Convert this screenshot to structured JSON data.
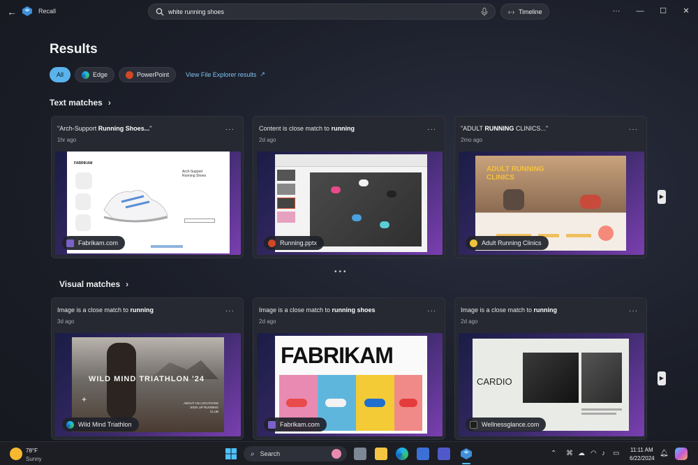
{
  "app": {
    "title": "Recall"
  },
  "search": {
    "value": "white running shoes"
  },
  "timeline": {
    "label": "Timeline"
  },
  "results": {
    "title": "Results",
    "filters": [
      {
        "label": "All",
        "active": true
      },
      {
        "label": "Edge",
        "active": false
      },
      {
        "label": "PowerPoint",
        "active": false
      }
    ],
    "file_explorer_link": "View File Explorer results"
  },
  "text_matches": {
    "title": "Text matches",
    "cards": [
      {
        "caption_pre": "\"Arch-Support ",
        "caption_bold": "Running Shoes...",
        "caption_post": "\"",
        "time": "1hr ago",
        "source": "Fabrikam.com",
        "source_icon": "fabrikam-icon"
      },
      {
        "caption_pre": "Content is close match to ",
        "caption_bold": "running",
        "caption_post": "",
        "time": "2d ago",
        "source": "Running.pptx",
        "source_icon": "powerpoint-icon"
      },
      {
        "caption_pre": "\"ADULT ",
        "caption_bold": "RUNNING",
        "caption_post": " CLINICS...\"",
        "time": "2mo ago",
        "source": "Adult Running Clinics",
        "source_icon": "yellow-circle-icon"
      }
    ]
  },
  "visual_matches": {
    "title": "Visual matches",
    "cards": [
      {
        "caption_pre": "Image is a close match to ",
        "caption_bold": "running",
        "caption_post": "",
        "time": "3d ago",
        "source": "Wild Mind Triathlon",
        "source_icon": "edge-icon"
      },
      {
        "caption_pre": "Image is a close match to ",
        "caption_bold": "running shoes",
        "caption_post": "",
        "time": "2d ago",
        "source": "Fabrikam.com",
        "source_icon": "fabrikam-icon"
      },
      {
        "caption_pre": "Image is a close match to ",
        "caption_bold": "running",
        "caption_post": "",
        "time": "2d ago",
        "source": "Wellnessglance.com",
        "source_icon": "wellness-icon"
      }
    ]
  },
  "thumbnails": {
    "fabrikam_logo": "FABRIKAM",
    "arch_title": "Arch-Support Running Shoes",
    "adult_clinics": "ADULT RUNNING CLINICS",
    "triathlon": "WILD MIND TRIATHLON '24",
    "cardio": "CARDIO",
    "about_us": "ABOUT US LOCATIONS SIGN UP RUNNING CLUB"
  },
  "taskbar": {
    "weather_temp": "78°F",
    "weather_desc": "Sunny",
    "search_label": "Search",
    "time": "11:11 AM",
    "date": "6/22/2024"
  },
  "colors": {
    "accent": "#5ab3ea",
    "link": "#7cc4f2"
  }
}
